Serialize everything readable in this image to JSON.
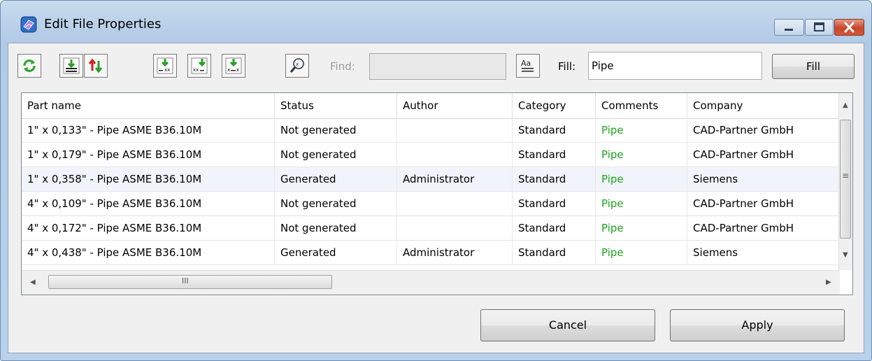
{
  "window": {
    "title": "Edit File Properties"
  },
  "toolbar": {
    "buttons": [
      {
        "icon": "refresh-icon"
      },
      {
        "icon": "import-list-icon"
      },
      {
        "icon": "swap-rows-icon"
      },
      {
        "icon": "fill-down-suffix-icon"
      },
      {
        "icon": "fill-down-prefix-icon"
      },
      {
        "icon": "fill-down-replace-icon"
      },
      {
        "icon": "magnifier-icon"
      },
      {
        "icon": "case-sensitive-icon"
      }
    ],
    "find_label": "Find:",
    "find_value": "",
    "fill_label": "Fill:",
    "fill_value": "Pipe",
    "fill_button": "Fill"
  },
  "table": {
    "columns": [
      "Part name",
      "Status",
      "Author",
      "Category",
      "Comments",
      "Company"
    ],
    "rows": [
      [
        "1\" x 0,133\" - Pipe ASME B36.10M",
        "Not generated",
        "",
        "Standard",
        "Pipe",
        "CAD-Partner GmbH"
      ],
      [
        "1\" x 0,179\" - Pipe ASME B36.10M",
        "Not generated",
        "",
        "Standard",
        "Pipe",
        "CAD-Partner GmbH"
      ],
      [
        "1\" x 0,358\" - Pipe ASME B36.10M",
        "Generated",
        "Administrator",
        "Standard",
        "Pipe",
        "Siemens"
      ],
      [
        "4\" x 0,109\" - Pipe ASME B36.10M",
        "Not generated",
        "",
        "Standard",
        "Pipe",
        "CAD-Partner GmbH"
      ],
      [
        "4\" x 0,172\" - Pipe ASME B36.10M",
        "Not generated",
        "",
        "Standard",
        "Pipe",
        "CAD-Partner GmbH"
      ],
      [
        "4\" x 0,438\" - Pipe ASME B36.10M",
        "Generated",
        "Administrator",
        "Standard",
        "Pipe",
        "Siemens"
      ]
    ],
    "hscroll_grip": "III",
    "vscroll_grip": "≡"
  },
  "footer": {
    "cancel": "Cancel",
    "apply": "Apply"
  },
  "colors": {
    "comments_text": "#1fa51f",
    "title_bar": "#bcd2ea",
    "close_button": "#c8452b"
  }
}
